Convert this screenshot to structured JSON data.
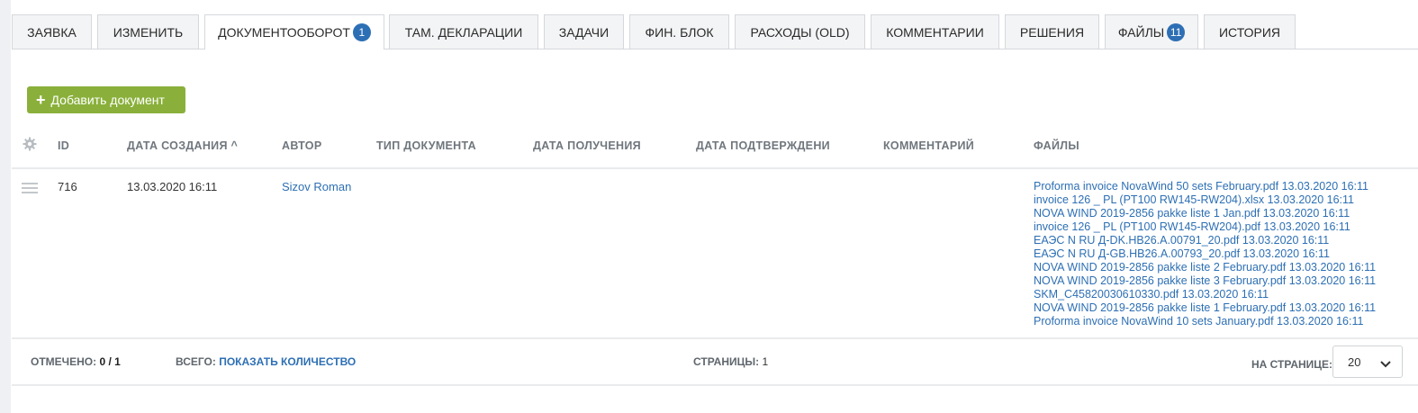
{
  "tabs": [
    {
      "label": "Заявка"
    },
    {
      "label": "Изменить"
    },
    {
      "label": "Документооборот",
      "badge": "1"
    },
    {
      "label": "Там. декларации"
    },
    {
      "label": "Задачи"
    },
    {
      "label": "Фин. блок"
    },
    {
      "label": "Расходы (OLD)"
    },
    {
      "label": "Комментарии"
    },
    {
      "label": "Решения"
    },
    {
      "label": "Файлы",
      "badge": "11"
    },
    {
      "label": "История"
    }
  ],
  "active_tab": "Документооборот",
  "toolbar": {
    "add_label": "Добавить документ"
  },
  "table": {
    "columns": [
      "ID",
      "ДАТА СОЗДАНИЯ",
      "АВТОР",
      "ТИП ДОКУМЕНТА",
      "ДАТА ПОЛУЧЕНИЯ",
      "ДАТА ПОДТВЕРЖДЕНИ",
      "КОММЕНТАРИЙ",
      "ФАЙЛЫ"
    ],
    "sort_indicator": "^",
    "rows": [
      {
        "id": "716",
        "created": "13.03.2020 16:11",
        "author": "Sizov Roman",
        "doc_type": "",
        "received": "",
        "confirmed": "",
        "comment": "",
        "files": [
          "Proforma invoice NovaWind 50 sets February.pdf 13.03.2020 16:11",
          "invoice 126 _ PL (PT100 RW145-RW204).xlsx 13.03.2020 16:11",
          "NOVA WIND 2019-2856 pakke liste 1 Jan.pdf 13.03.2020 16:11",
          "invoice 126 _ PL (PT100 RW145-RW204).pdf 13.03.2020 16:11",
          "ЕАЭС N RU Д-DK.НВ26.А.00791_20.pdf 13.03.2020 16:11",
          "ЕАЭС N RU Д-GB.НВ26.А.00793_20.pdf 13.03.2020 16:11",
          "NOVA WIND 2019-2856 pakke liste 2 February.pdf 13.03.2020 16:11",
          "NOVA WIND 2019-2856 pakke liste 3 February.pdf 13.03.2020 16:11",
          "SKM_C45820030610330.pdf 13.03.2020 16:11",
          "NOVA WIND 2019-2856 pakke liste 1 February.pdf 13.03.2020 16:11",
          "Proforma invoice NovaWind 10 sets January.pdf 13.03.2020 16:11"
        ]
      }
    ]
  },
  "footer": {
    "checked_label": "ОТМЕЧЕНО:",
    "checked_value": "0 / 1",
    "total_label": "ВСЕГО:",
    "total_link": "ПОКАЗАТЬ КОЛИЧЕСТВО",
    "pages_label": "СТРАНИЦЫ:",
    "pages_value": "1",
    "per_page_label": "НА СТРАНИЦЕ:",
    "per_page_value": "20"
  },
  "colors": {
    "accent": "#2d6fb4",
    "add_button": "#8ab03b",
    "tab_bg": "#f3f4f5"
  },
  "icons": {
    "add": "plus-icon",
    "settings": "gear-icon",
    "drag": "drag-handle-icon",
    "dropdown": "chevron-down-icon"
  }
}
